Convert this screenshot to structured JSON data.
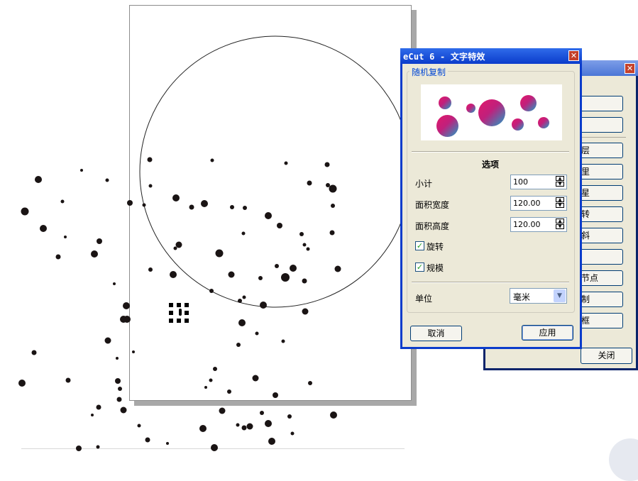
{
  "dialog": {
    "title": "eCut 6 - 文字特效",
    "group_label": "随机复制",
    "section_title": "选项",
    "fields": [
      {
        "label": "小计",
        "value": "100"
      },
      {
        "label": "面积宽度",
        "value": "120.00"
      },
      {
        "label": "面积高度",
        "value": "120.00"
      }
    ],
    "checkboxes": [
      {
        "label": "旋转",
        "checked": true
      },
      {
        "label": "规模",
        "checked": true
      }
    ],
    "unit": {
      "label": "单位",
      "value": "毫米"
    },
    "cancel_label": "取消",
    "apply_label": "应用",
    "close_symbol": "✕"
  },
  "back_dialog": {
    "close_symbol": "✕",
    "partial_labels": [
      "",
      "",
      "层",
      "里",
      "星",
      "转",
      "斜",
      "",
      "节点",
      "制",
      "框"
    ],
    "close_label": "关闭"
  },
  "colors": {
    "titlebar": "#0b3ccb",
    "dialog_bg": "#ece9d8",
    "group_label": "#0046d5",
    "dot": "#1a1414"
  },
  "icons": {
    "close": "close-icon",
    "spin": "spin-arrows-icon",
    "dropdown": "chevron-down-icon",
    "check": "checkmark-icon"
  }
}
